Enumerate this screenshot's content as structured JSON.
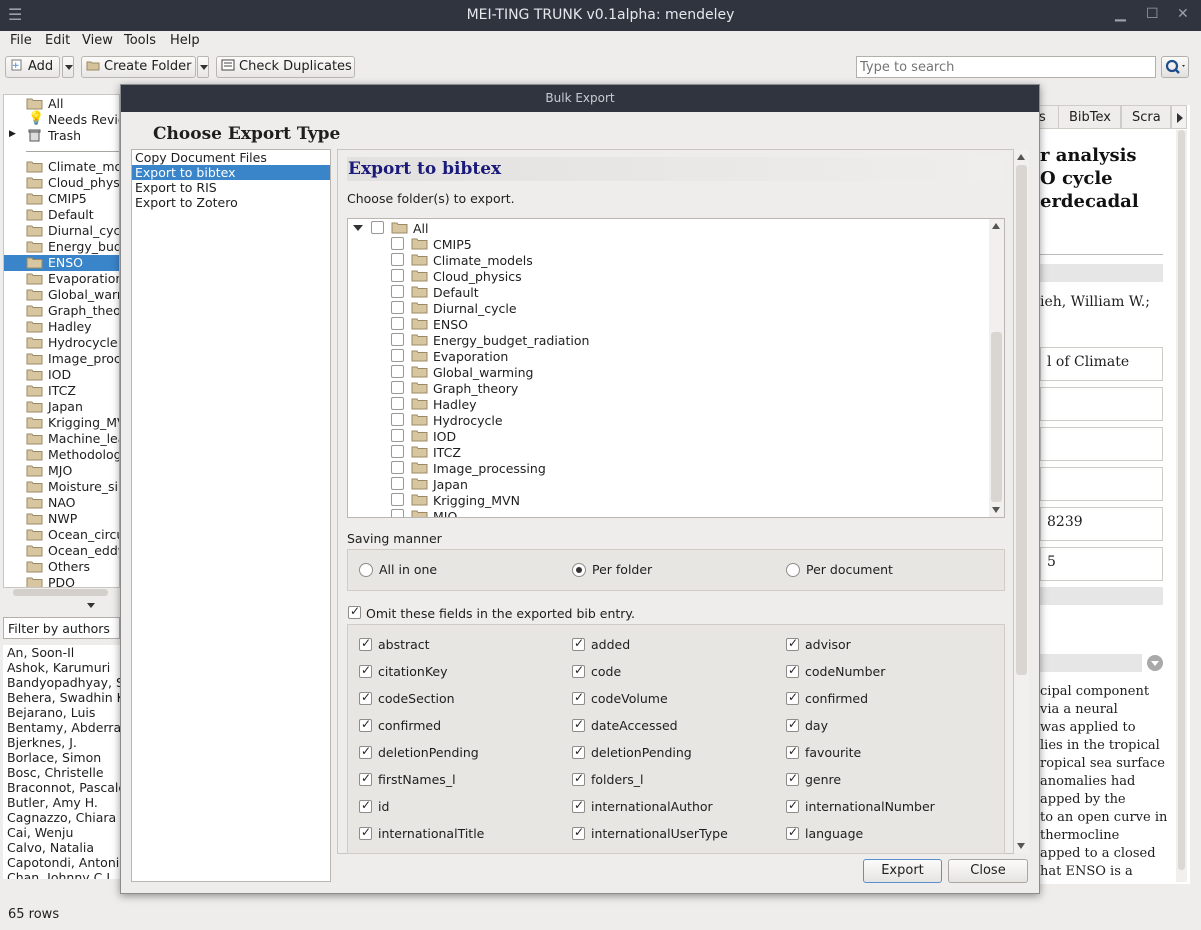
{
  "window": {
    "title": "MEI-TING TRUNK v0.1alpha: mendeley"
  },
  "menu": [
    "File",
    "Edit",
    "View",
    "Tools",
    "Help"
  ],
  "toolbar": {
    "add_label": "Add",
    "create_folder_label": "Create Folder",
    "check_duplicates_label": "Check Duplicates"
  },
  "search": {
    "placeholder": "Type to search"
  },
  "folders": {
    "top": [
      "All",
      "Needs Revie",
      "Trash"
    ],
    "items": [
      "Climate_mo",
      "Cloud_physi",
      "CMIP5",
      "Default",
      "Diurnal_cycl",
      "Energy_budg",
      "ENSO",
      "Evaporation",
      "Global_warn",
      "Graph_theor",
      "Hadley",
      "Hydrocycle",
      "Image_proce",
      "IOD",
      "ITCZ",
      "Japan",
      "Krigging_MV",
      "Machine_lea",
      "Methodolog",
      "MJO",
      "Moisture_sir",
      "NAO",
      "NWP",
      "Ocean_circu",
      "Ocean_eddy",
      "Others",
      "PDO"
    ],
    "selected": "ENSO"
  },
  "filter": {
    "value": "Filter by authors"
  },
  "authors": [
    "An, Soon-Il",
    "Ashok, Karumuri",
    "Bandyopadhyay, S",
    "Behera, Swadhin K",
    "Bejarano, Luis",
    "Bentamy, Abderrah",
    "Bjerknes, J.",
    "Borlace, Simon",
    "Bosc, Christelle",
    "Braconnot, Pascale",
    "Butler, Amy H.",
    "Cagnazzo, Chiara",
    "Cai, Wenju",
    "Calvo, Natalia",
    "Capotondi, Antonie",
    "Chan, Johnny C.L."
  ],
  "status": {
    "rows": "65 rows"
  },
  "right_panel": {
    "tabs": [
      "s",
      "BibTex",
      "Scra"
    ],
    "title_lines": [
      "r analysis",
      "O cycle",
      "erdecadal"
    ],
    "authors": "ieh, William W.;",
    "journal": "l of Climate",
    "field_a": "8239",
    "field_b": "5",
    "abstract_lines": [
      "cipal component",
      "via a neural",
      "was applied to",
      "lies in the tropical",
      "ropical sea surface",
      "anomalies had",
      "apped by the",
      "to an open curve in",
      "thermocline",
      "apped to a closed",
      "hat ENSO is a"
    ]
  },
  "dialog": {
    "title": "Bulk Export",
    "heading": "Choose Export Type",
    "types": [
      "Copy Document Files",
      "Export to bibtex",
      "Export to RIS",
      "Export to Zotero"
    ],
    "selected_type": "Export to bibtex",
    "export_heading": "Export to bibtex",
    "choose_folders": "Choose folder(s) to export.",
    "tree_root": "All",
    "tree_items": [
      "CMIP5",
      "Climate_models",
      "Cloud_physics",
      "Default",
      "Diurnal_cycle",
      "ENSO",
      "Energy_budget_radiation",
      "Evaporation",
      "Global_warming",
      "Graph_theory",
      "Hadley",
      "Hydrocycle",
      "IOD",
      "ITCZ",
      "Image_processing",
      "Japan",
      "Krigging_MVN",
      "MJO"
    ],
    "saving_label": "Saving manner",
    "saving_options": [
      "All in one",
      "Per folder",
      "Per document"
    ],
    "saving_selected": "Per folder",
    "omit_label": "Omit these fields in the exported bib entry.",
    "omit_fields": [
      "abstract",
      "added",
      "advisor",
      "citationKey",
      "code",
      "codeNumber",
      "codeSection",
      "codeVolume",
      "confirmed",
      "confirmed",
      "dateAccessed",
      "day",
      "deletionPending",
      "deletionPending",
      "favourite",
      "firstNames_l",
      "folders_l",
      "genre",
      "id",
      "internationalAuthor",
      "internationalNumber",
      "internationalTitle",
      "internationalUserType",
      "language"
    ],
    "export_button": "Export",
    "close_button": "Close"
  },
  "colors": {
    "titlebar": "#2f343f",
    "selection": "#3a84c9",
    "heading": "#1a1a7a"
  }
}
